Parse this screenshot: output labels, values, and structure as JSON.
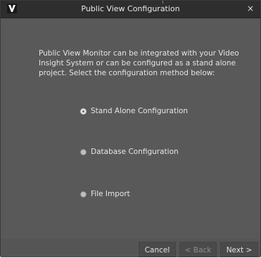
{
  "window": {
    "title": "Public View Configuration",
    "logo_letter": "V",
    "close_icon": "×"
  },
  "intro": {
    "text": "Public View Monitor can be integrated with your Video\nInsight System or can be configured as a stand alone\nproject.  Select the configuration method below:"
  },
  "options": [
    {
      "label": "Stand Alone Configuration",
      "selected": true
    },
    {
      "label": "Database Configuration",
      "selected": false
    },
    {
      "label": "File Import",
      "selected": false
    }
  ],
  "buttons": {
    "cancel": "Cancel",
    "back": "< Back",
    "next": "Next >"
  },
  "colors": {
    "window_bg": "#575757",
    "titlebar_bg": "#2e2e2e",
    "text": "#e4e4e4",
    "disabled_text": "#8d8d8d"
  }
}
